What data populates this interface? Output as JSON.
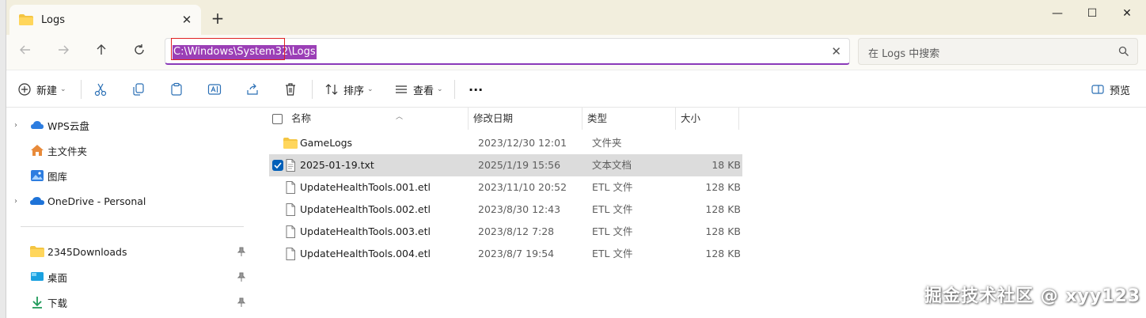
{
  "window": {
    "tab_title": "Logs",
    "tab_close": "✕",
    "tab_add": "+",
    "controls": {
      "minimize": "—",
      "maximize": "☐",
      "close": "✕"
    }
  },
  "address": {
    "path": "C:\\Windows\\System32\\Logs",
    "clear": "✕"
  },
  "search": {
    "placeholder": "在 Logs 中搜索"
  },
  "commands": {
    "new_label": "新建",
    "sort_label": "排序",
    "view_label": "查看",
    "more_label": "···",
    "preview_label": "预览"
  },
  "nav": {
    "items": [
      {
        "label": "WPS云盘",
        "icon": "cloud-icon"
      },
      {
        "label": "主文件夹",
        "icon": "home-icon"
      },
      {
        "label": "图库",
        "icon": "gallery-icon"
      },
      {
        "label": "OneDrive - Personal",
        "icon": "onedrive-icon"
      },
      {
        "label": "2345Downloads",
        "icon": "folder-icon"
      },
      {
        "label": "桌面",
        "icon": "desktop-icon"
      },
      {
        "label": "下载",
        "icon": "download-icon"
      }
    ]
  },
  "list": {
    "columns": {
      "name": "名称",
      "modified": "修改日期",
      "type": "类型",
      "size": "大小"
    },
    "rows": [
      {
        "name": "GameLogs",
        "modified": "2023/12/30 12:01",
        "type": "文件夹",
        "size": "",
        "kind": "folder",
        "selected": false
      },
      {
        "name": "2025-01-19.txt",
        "modified": "2025/1/19 15:56",
        "type": "文本文档",
        "size": "18 KB",
        "kind": "file",
        "selected": true
      },
      {
        "name": "UpdateHealthTools.001.etl",
        "modified": "2023/11/10 20:52",
        "type": "ETL 文件",
        "size": "128 KB",
        "kind": "file",
        "selected": false
      },
      {
        "name": "UpdateHealthTools.002.etl",
        "modified": "2023/8/30 12:43",
        "type": "ETL 文件",
        "size": "128 KB",
        "kind": "file",
        "selected": false
      },
      {
        "name": "UpdateHealthTools.003.etl",
        "modified": "2023/8/12 7:28",
        "type": "ETL 文件",
        "size": "128 KB",
        "kind": "file",
        "selected": false
      },
      {
        "name": "UpdateHealthTools.004.etl",
        "modified": "2023/8/7 19:54",
        "type": "ETL 文件",
        "size": "128 KB",
        "kind": "file",
        "selected": false
      }
    ]
  },
  "watermark": "掘金技术社区 @ xyy123",
  "colors": {
    "accent": "#005fb8",
    "selection_highlight": "#9b3fb6",
    "title_bar": "#f2eedd"
  }
}
